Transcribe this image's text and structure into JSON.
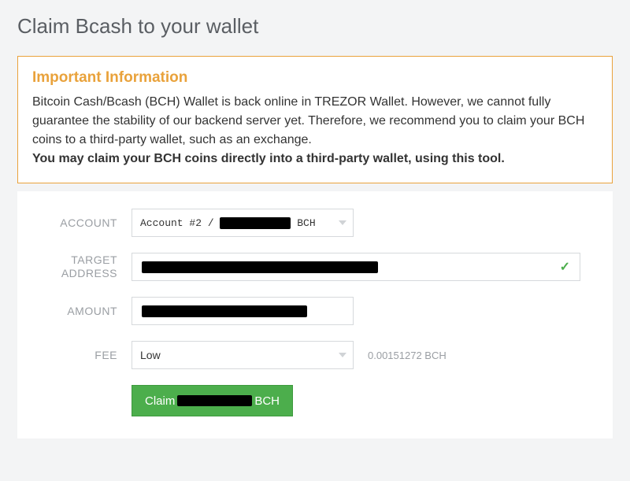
{
  "page_title": "Claim Bcash to your wallet",
  "info": {
    "title": "Important Information",
    "body": "Bitcoin Cash/Bcash (BCH) Wallet is back online in TREZOR Wallet. However, we cannot fully guarantee the stability of our backend server yet. Therefore, we recommend you to claim your BCH coins to a third-party wallet, such as an exchange.",
    "bold": "You may claim your BCH coins directly into a third-party wallet, using this tool."
  },
  "form": {
    "account": {
      "label": "ACCOUNT",
      "value_prefix": "Account #2 / ",
      "value_suffix": " BCH"
    },
    "target_address": {
      "label": "TARGET ADDRESS",
      "valid": true
    },
    "amount": {
      "label": "AMOUNT"
    },
    "fee": {
      "label": "FEE",
      "selected": "Low",
      "note": "0.00151272 BCH"
    },
    "button": {
      "prefix": "Claim",
      "suffix": "BCH"
    }
  }
}
